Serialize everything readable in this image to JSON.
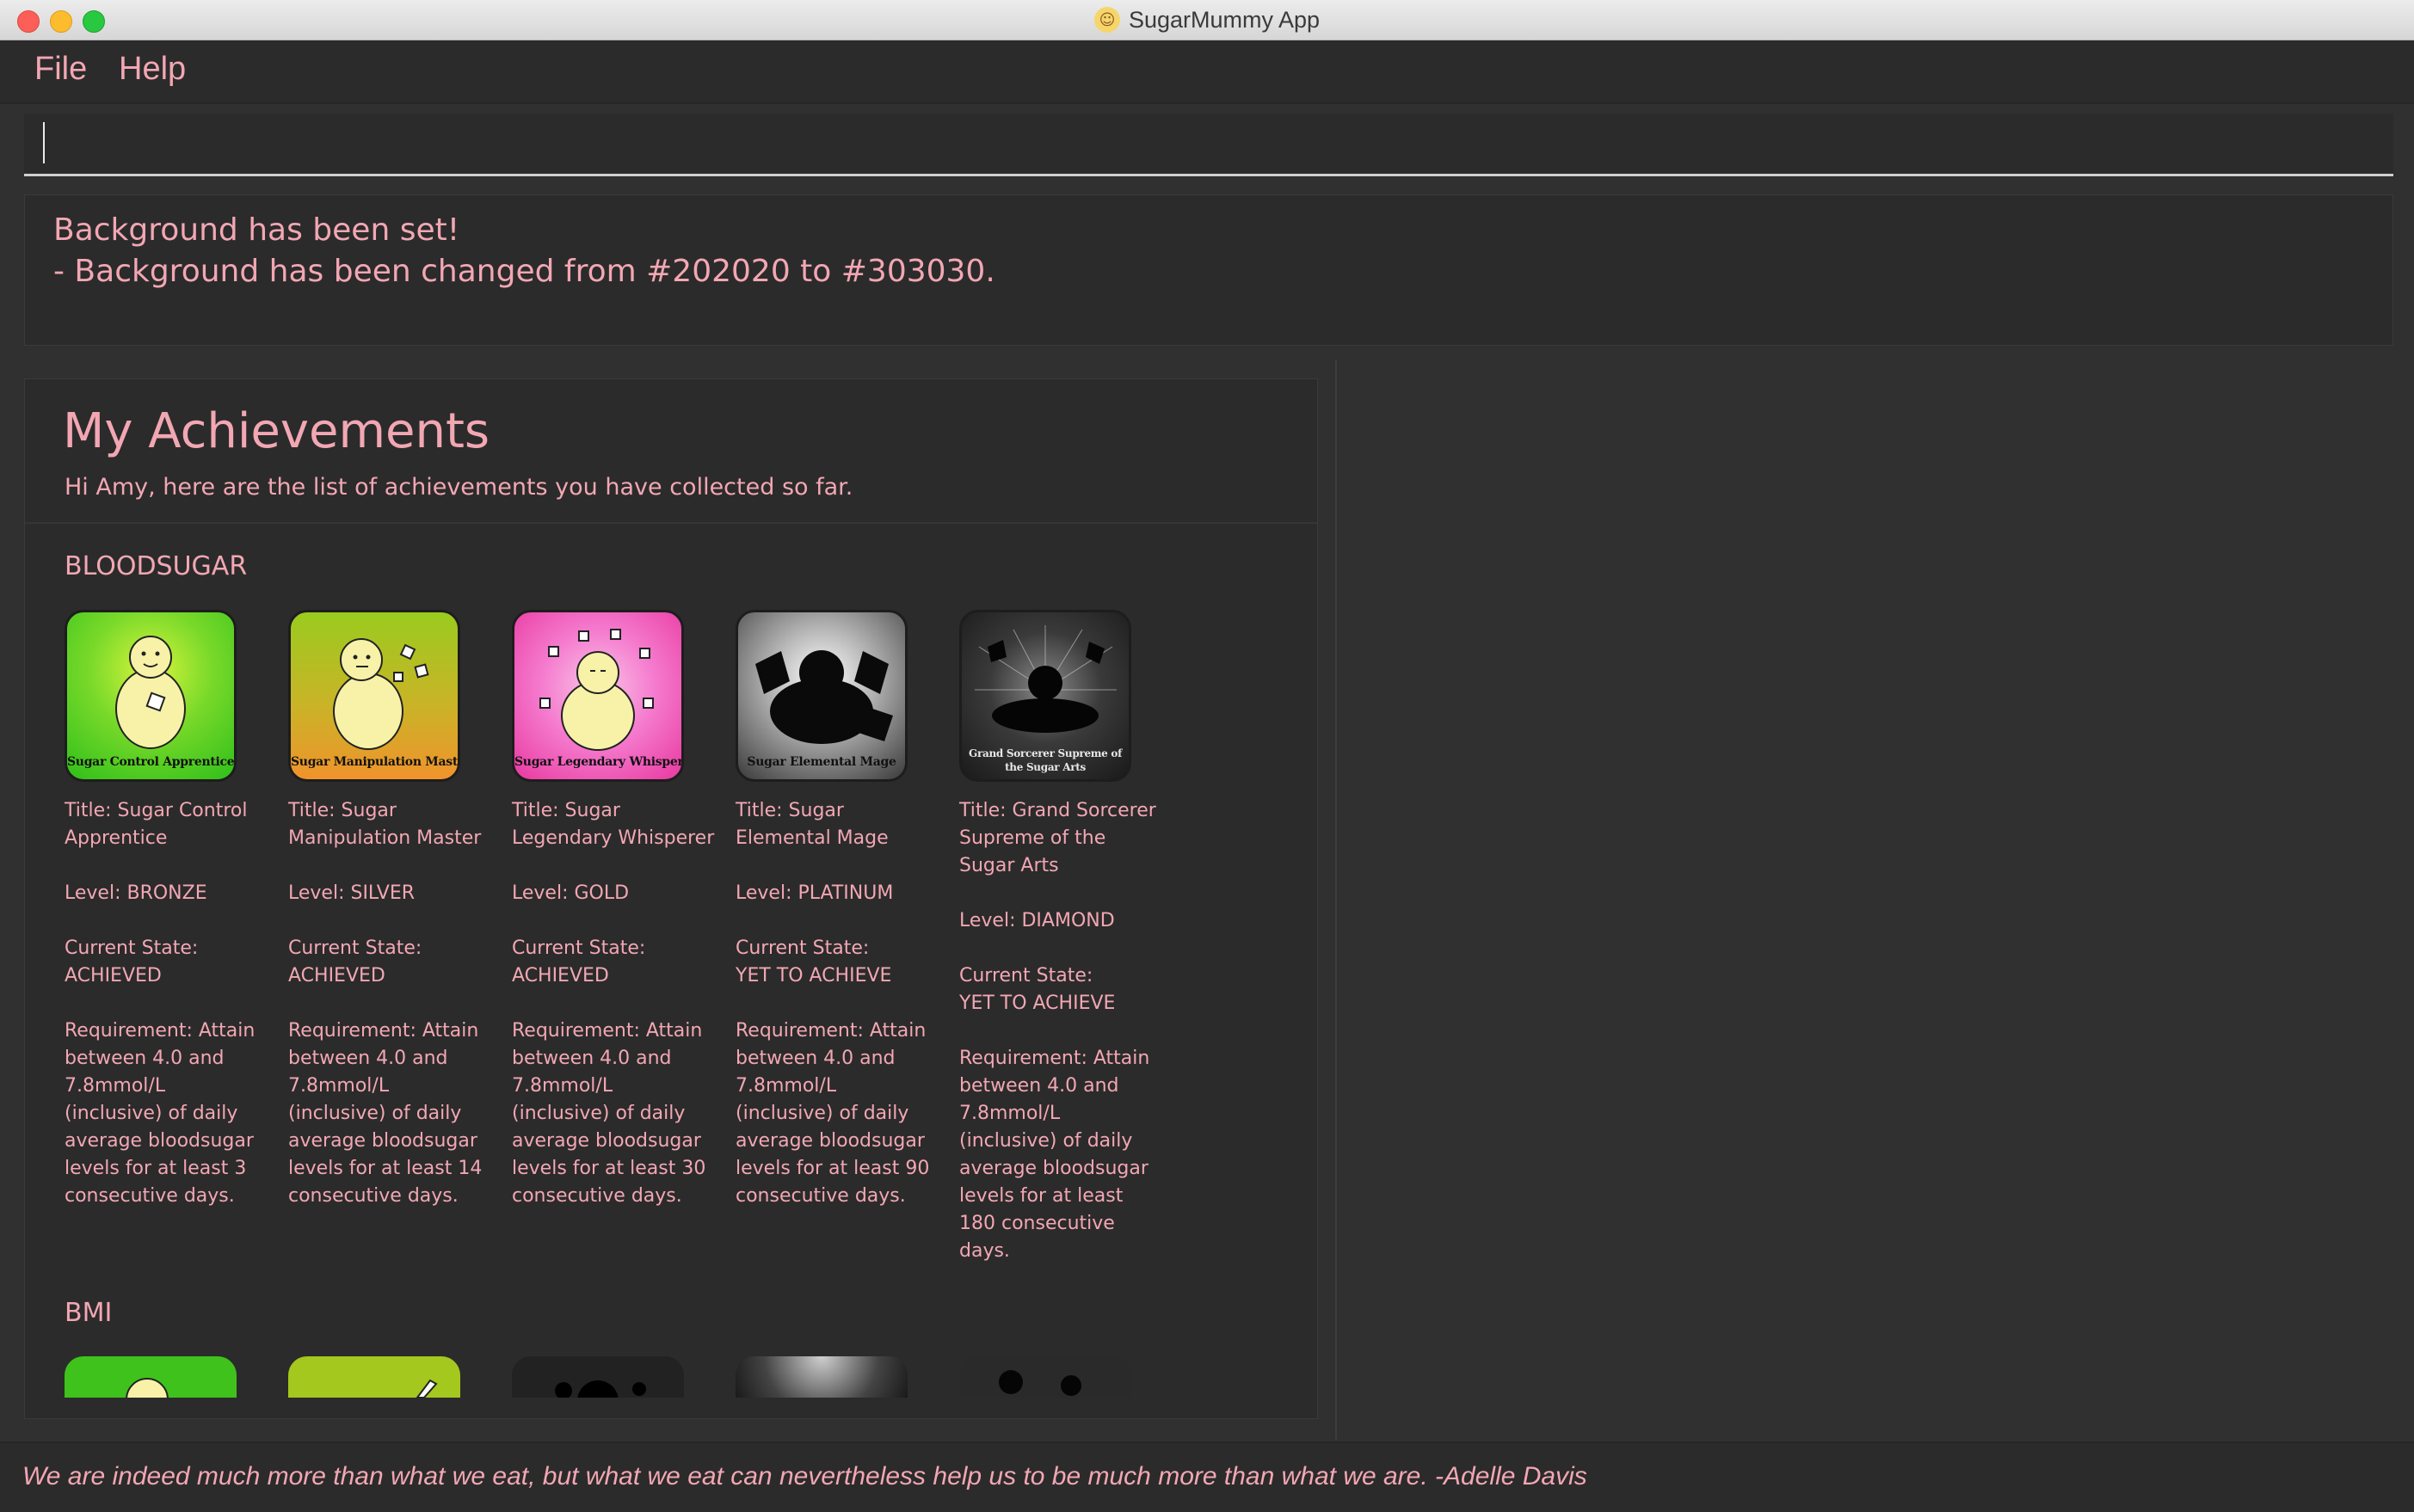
{
  "window": {
    "title": "SugarMummy App"
  },
  "menu": {
    "items": [
      "File",
      "Help"
    ]
  },
  "command": {
    "value": ""
  },
  "result": {
    "line1": "Background has been set!",
    "line2": "- Background has been changed from #202020 to #303030."
  },
  "achievements": {
    "title": "My Achievements",
    "subtitle": "Hi Amy, here are the list of achievements you have collected so far.",
    "sections": [
      {
        "label": "BLOODSUGAR",
        "cards": [
          {
            "badge_caption": "Sugar Control Apprentice",
            "title": "Title: Sugar Control Apprentice",
            "level": "Level: BRONZE",
            "state_label": "Current State:",
            "state": "ACHIEVED",
            "requirement": "Requirement: Attain between 4.0 and 7.8mmol/L (inclusive) of daily average bloodsugar levels for at least 3 consecutive days."
          },
          {
            "badge_caption": "Sugar Manipulation Master",
            "title": "Title: Sugar Manipulation Master",
            "level": "Level: SILVER",
            "state_label": "Current State:",
            "state": "ACHIEVED",
            "requirement": "Requirement: Attain between 4.0 and 7.8mmol/L (inclusive) of daily average bloodsugar levels for at least 14 consecutive days."
          },
          {
            "badge_caption": "Sugar Legendary Whisperer",
            "title": "Title: Sugar Legendary Whisperer",
            "level": "Level: GOLD",
            "state_label": "Current State:",
            "state": "ACHIEVED",
            "requirement": "Requirement: Attain between 4.0 and 7.8mmol/L (inclusive) of daily average bloodsugar levels for at least 30 consecutive days."
          },
          {
            "badge_caption": "Sugar Elemental Mage",
            "title": "Title: Sugar Elemental Mage",
            "level": "Level: PLATINUM",
            "state_label": "Current State:",
            "state": "YET TO ACHIEVE",
            "requirement": "Requirement: Attain between 4.0 and 7.8mmol/L (inclusive) of daily average bloodsugar levels for at least 90 consecutive days."
          },
          {
            "badge_caption": "Grand Sorcerer Supreme of the Sugar Arts",
            "title": "Title: Grand Sorcerer Supreme of the Sugar Arts",
            "level": "Level: DIAMOND",
            "state_label": "Current State:",
            "state": "YET TO ACHIEVE",
            "requirement": "Requirement: Attain between 4.0 and 7.8mmol/L (inclusive) of daily average bloodsugar levels for at least 180 consecutive days."
          }
        ]
      },
      {
        "label": "BMI"
      }
    ]
  },
  "quote": "We are indeed much more than what we eat, but what we eat can nevertheless help us to be much more than what we are. -Adelle Davis",
  "colors": {
    "background": "#303030",
    "panel": "#2b2b2b",
    "accent_text": "#f2a7b3",
    "bronze_badge": "#2fbf1a",
    "silver_badge": "#d8a528",
    "gold_badge": "#f04fb6",
    "platinum_badge": "#6e6e6e",
    "diamond_badge": "#2a2a2a"
  }
}
